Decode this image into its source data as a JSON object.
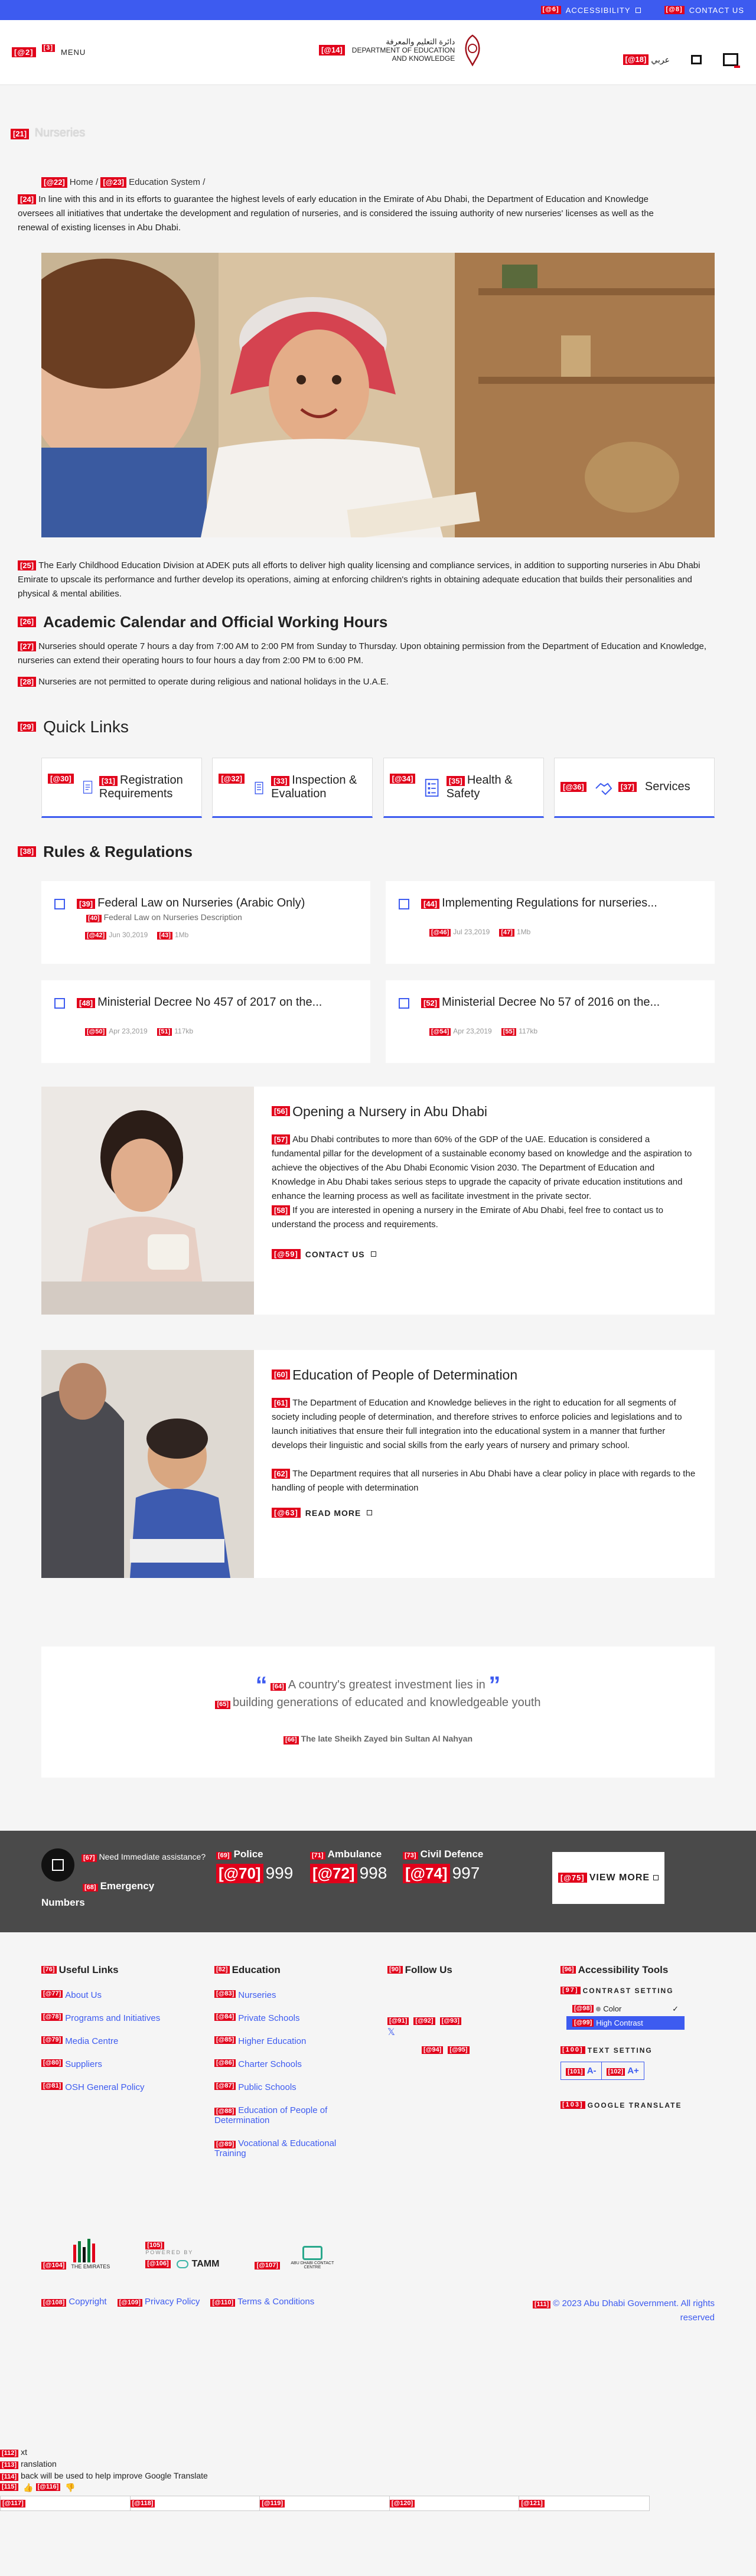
{
  "topbar": {
    "accessibility_tag": "[@6]",
    "accessibility": "ACCESSIBILITY",
    "contact_tag": "[@8]",
    "contact": "CONTACT US"
  },
  "header": {
    "menu_tag": "[@2]",
    "menu_tag2": "[3]",
    "menu": "MENU",
    "logo_tag": "[@14]",
    "logo_ar": "دائرة التعليم والمعرفة",
    "logo_line1": "DEPARTMENT OF EDUCATION",
    "logo_line2": "AND KNOWLEDGE",
    "lang_tag": "[@18]",
    "lang": "عربي"
  },
  "hero": {
    "tag": "[21]",
    "title": "Nurseries"
  },
  "breadcrumb": {
    "home_tag": "[@22]",
    "home": "Home",
    "edu_tag": "[@23]",
    "edu": "Education System"
  },
  "intro": {
    "tag": "[24]",
    "text": "In line with this and in its efforts to guarantee the highest levels of early education in the Emirate of Abu Dhabi, the Department of Education and Knowledge oversees all initiatives that undertake the development and regulation of nurseries, and is considered the issuing authority of new nurseries' licenses as well as the renewal of existing licenses in Abu Dhabi."
  },
  "ecd": {
    "tag": "[25]",
    "text": "The Early Childhood Education Division at ADEK puts all efforts to deliver high quality licensing and compliance services, in addition to supporting nurseries in Abu Dhabi Emirate to upscale its performance and further develop its operations, aiming at enforcing children's rights in obtaining adequate education that builds their personalities and physical & mental abilities."
  },
  "calendar": {
    "tag": "[26]",
    "title": "Academic Calendar and Official Working Hours",
    "p1_tag": "[27]",
    "p1": "Nurseries should operate 7 hours a day from 7:00 AM to 2:00  PM from Sunday to Thursday. Upon obtaining permission from the Department of Education and Knowledge, nurseries can extend their operating hours to four hours a day from 2:00 PM to 6:00 PM.",
    "p2_tag": "[28]",
    "p2": "Nurseries are not permitted to operate during religious and national holidays in the U.A.E."
  },
  "quick_links": {
    "tag": "[29]",
    "title": "Quick Links",
    "items": [
      {
        "tag": "[@30]",
        "label_tag": "[31]",
        "label": "Registration Requirements",
        "icon": "document-icon"
      },
      {
        "tag": "[@32]",
        "label_tag": "[33]",
        "label": "Inspection & Evaluation",
        "icon": "building-icon"
      },
      {
        "tag": "[@34]",
        "label_tag": "[35]",
        "label": "Health & Safety",
        "icon": "checklist-icon"
      },
      {
        "tag": "[@36]",
        "label_tag": "[37]",
        "label": "Services",
        "icon": "handshake-icon"
      }
    ]
  },
  "rules": {
    "tag": "[38]",
    "title": "Rules & Regulations",
    "items": [
      {
        "tag": "[39]",
        "title": "Federal Law on Nurseries (Arabic Only)",
        "desc_tag": "[40]",
        "desc": "Federal Law on Nurseries Description",
        "date_tag": "[@42]",
        "date": "Jun 30,2019",
        "size_tag": "[43]",
        "size": "1Mb"
      },
      {
        "tag": "[44]",
        "title": "Implementing Regulations for nurseries...",
        "desc_tag": "",
        "desc": "",
        "date_tag": "[@46]",
        "date": "Jul 23,2019",
        "size_tag": "[47]",
        "size": "1Mb"
      },
      {
        "tag": "[48]",
        "title": "Ministerial Decree No 457 of 2017 on the...",
        "desc_tag": "",
        "desc": "",
        "date_tag": "[@50]",
        "date": "Apr 23,2019",
        "size_tag": "[51]",
        "size": "117kb"
      },
      {
        "tag": "[52]",
        "title": "Ministerial Decree No 57 of 2016 on the...",
        "desc_tag": "",
        "desc": "",
        "date_tag": "[@54]",
        "date": "Apr 23,2019",
        "size_tag": "[55]",
        "size": "117kb"
      }
    ]
  },
  "opening": {
    "tag": "[56]",
    "title": "Opening a Nursery in Abu Dhabi",
    "p1_tag": "[57]",
    "p1": "Abu Dhabi contributes to more than 60% of the GDP of the UAE. Education is considered a fundamental pillar for the development of a sustainable economy based on knowledge and the aspiration to achieve the objectives of the Abu Dhabi Economic Vision 2030. The Department of Education and Knowledge in Abu Dhabi takes serious steps to upgrade the capacity of private education institutions and enhance the learning process as well as facilitate investment in the private sector.",
    "p2_tag": "[58]",
    "p2": "If you are interested in opening a nursery in the Emirate of Abu Dhabi, feel free to contact us to understand the process and requirements.",
    "cta_tag": "[@59]",
    "cta": "CONTACT US"
  },
  "determination": {
    "tag": "[60]",
    "title": "Education of People of Determination",
    "p1_tag": "[61]",
    "p1": "The Department of Education and Knowledge believes in the right to education for all segments of society including people of determination, and therefore strives to enforce policies and legislations and to launch initiatives that ensure their full integration into the educational system in a manner that further develops their linguistic and social skills from the early years of nursery and primary school.",
    "p2_tag": "[62]",
    "p2": "The Department requires that all nurseries in Abu Dhabi have a clear policy in place with regards to the handling of people with determination",
    "cta_tag": "[@63]",
    "cta": "READ MORE"
  },
  "quote": {
    "l1_tag": "[64]",
    "line1": "A country's greatest investment lies in",
    "l2_tag": "[65]",
    "line2": "building generations of educated and knowledgeable youth",
    "author_tag": "[66]",
    "author": "The late Sheikh Zayed bin Sultan Al Nahyan"
  },
  "emergency": {
    "help_tag": "[67]",
    "help": "Need Immediate assistance?",
    "numbers_tag": "[68]",
    "numbers": "Emergency Numbers",
    "police_tag": "[69]",
    "police": "Police",
    "police_num_tag": "[@70]",
    "police_num": "999",
    "amb_tag": "[71]",
    "amb": "Ambulance",
    "amb_num_tag": "[@72]",
    "amb_num": "998",
    "civil_tag": "[73]",
    "civil": "Civil Defence",
    "civil_num_tag": "[@74]",
    "civil_num": "997",
    "more_tag": "[@75]",
    "more": "VIEW MORE"
  },
  "footer": {
    "useful": {
      "tag": "[76]",
      "title": "Useful Links",
      "links": [
        {
          "tag": "[@77]",
          "label": "About Us"
        },
        {
          "tag": "[@78]",
          "label": "Programs and Initiatives"
        },
        {
          "tag": "[@79]",
          "label": "Media Centre"
        },
        {
          "tag": "[@80]",
          "label": "Suppliers"
        },
        {
          "tag": "[@81]",
          "label": "OSH General Policy"
        }
      ]
    },
    "education": {
      "tag": "[82]",
      "title": "Education",
      "links": [
        {
          "tag": "[@83]",
          "label": "Nurseries"
        },
        {
          "tag": "[@84]",
          "label": "Private Schools"
        },
        {
          "tag": "[@85]",
          "label": "Higher Education"
        },
        {
          "tag": "[@86]",
          "label": "Charter Schools"
        },
        {
          "tag": "[@87]",
          "label": "Public Schools"
        },
        {
          "tag": "[@88]",
          "label": "Education of People of Determination"
        },
        {
          "tag": "[@89]",
          "label": "Vocational & Educational Training"
        }
      ]
    },
    "follow": {
      "tag": "[90]",
      "title": "Follow Us",
      "t91": "[@91]",
      "t92": "[@92]",
      "t93": "[@93]",
      "t94": "[@94]",
      "t95": "[@95]"
    },
    "access": {
      "tag": "[96]",
      "title": "Accessibility Tools",
      "contrast_tag": "[97]",
      "contrast": "CONTRAST SETTING",
      "color_tag": "[@98]",
      "color": "Color",
      "high_tag": "[@99]",
      "high": "High Contrast",
      "text_tag": "[100]",
      "text": "TEXT SETTING",
      "aminus_tag": "[101]",
      "aminus": "A-",
      "aplus_tag": "[102]",
      "aplus": "A+",
      "gt_tag": "[103]",
      "gt": "GOOGLE TRANSLATE"
    },
    "logos": {
      "uae_tag": "[@104]",
      "uae": "THE EMIRATES",
      "powered_tag": "[105]",
      "powered": "POWERED BY",
      "tamm_tag": "[@106]",
      "tamm": "TAMM",
      "contact_tag": "[@107]",
      "contact": "ABU DHABI CONTACT CENTRE"
    },
    "bottom": {
      "copy_tag": "[@108]",
      "copy": "Copyright",
      "priv_tag": "[@109]",
      "priv": "Privacy Policy",
      "terms_tag": "[@110]",
      "terms": "Terms & Conditions",
      "rights_tag": "[111]",
      "rights": "© 2023 Abu Dhabi Government. All rights reserved"
    }
  },
  "translate": {
    "t112": "[112]",
    "l112": "xt",
    "t113": "[113]",
    "l113": "ranslation",
    "t114": "[114]",
    "l114": "back will be used to help improve Google Translate",
    "t115": "[115]",
    "t116": "[@116]",
    "row": [
      "[@117]",
      "[@118]",
      "[@119]",
      "[@120]",
      "[@121]"
    ]
  },
  "colors": {
    "accent": "#3d5bf0",
    "tag": "#e1001a",
    "emergency_bg": "#4a4a4a"
  }
}
